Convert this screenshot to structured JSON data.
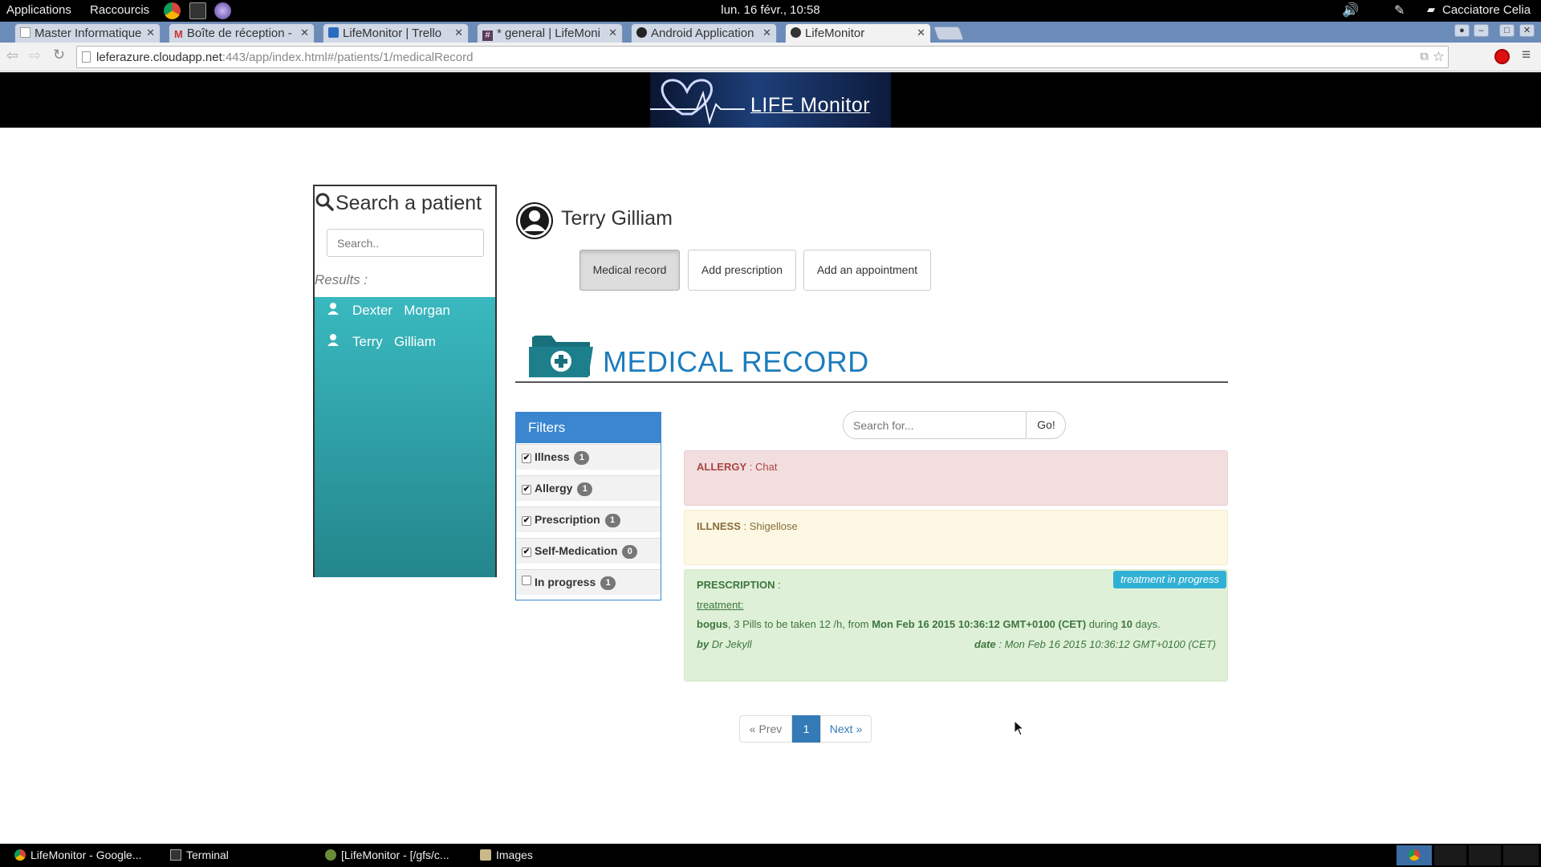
{
  "topbar": {
    "applications": "Applications",
    "shortcuts": "Raccourcis",
    "clock": "lun. 16 févr., 10:58",
    "user": "Cacciatore Celia"
  },
  "browser": {
    "tabs": [
      {
        "title": "Master Informatique"
      },
      {
        "title": "Boîte de réception -"
      },
      {
        "title": "LifeMonitor | Trello"
      },
      {
        "title": "* general | LifeMoni"
      },
      {
        "title": "Android Application"
      },
      {
        "title": "LifeMonitor"
      }
    ],
    "url_host": "leferazure.cloudapp.net",
    "url_rest": ":443/app/index.html#/patients/1/medicalRecord"
  },
  "site": {
    "logo_text": "LIFE Monitor"
  },
  "sidebar": {
    "title": "Search a patient",
    "search_placeholder": "Search..",
    "results_label": "Results :",
    "results": [
      {
        "first": "Dexter",
        "last": "Morgan"
      },
      {
        "first": "Terry",
        "last": "Gilliam"
      }
    ]
  },
  "patient": {
    "name": "Terry Gilliam",
    "actions": [
      {
        "label": "Medical record"
      },
      {
        "label": "Add prescription"
      },
      {
        "label": "Add an appointment"
      }
    ]
  },
  "medical_record": {
    "title": "MEDICAL RECORD",
    "filters_title": "Filters",
    "filters": [
      {
        "label": "Illness",
        "count": "1",
        "checked": true
      },
      {
        "label": "Allergy",
        "count": "1",
        "checked": true
      },
      {
        "label": "Prescription",
        "count": "1",
        "checked": true
      },
      {
        "label": "Self-Medication",
        "count": "0",
        "checked": true
      },
      {
        "label": "In progress",
        "count": "1",
        "checked": false
      }
    ],
    "search_placeholder": "Search for...",
    "go_label": "Go!",
    "records": {
      "allergy": {
        "type": "ALLERGY",
        "sep": " : ",
        "value": "Chat"
      },
      "illness": {
        "type": "ILLNESS",
        "sep": " : ",
        "value": "Shigellose"
      },
      "prescription": {
        "type": "PRESCRIPTION",
        "sep": " :",
        "status": "treatment in progress",
        "treatment_label": "treatment:",
        "drug": "bogus",
        "dosage": ", 3 Pills to be taken 12 /h, from ",
        "start": "Mon Feb 16 2015 10:36:12 GMT+0100 (CET)",
        "during_text": " during ",
        "duration": "10",
        "days_text": " days.",
        "by_label": "by",
        "doctor": "Dr Jekyll",
        "date_label": "date",
        "date_sep": " : ",
        "date": "Mon Feb 16 2015 10:36:12 GMT+0100 (CET)"
      }
    },
    "pagination": {
      "prev": "« Prev",
      "current": "1",
      "next": "Next »"
    }
  },
  "taskbar": {
    "items": [
      {
        "label": "LifeMonitor - Google..."
      },
      {
        "label": "Terminal"
      },
      {
        "label": "[LifeMonitor - [/gfs/c..."
      },
      {
        "label": "Images"
      }
    ]
  },
  "colors": {
    "accent_blue": "#1d7cbd",
    "filter_blue": "#3a86cf",
    "teal": "#2ea5ab"
  }
}
